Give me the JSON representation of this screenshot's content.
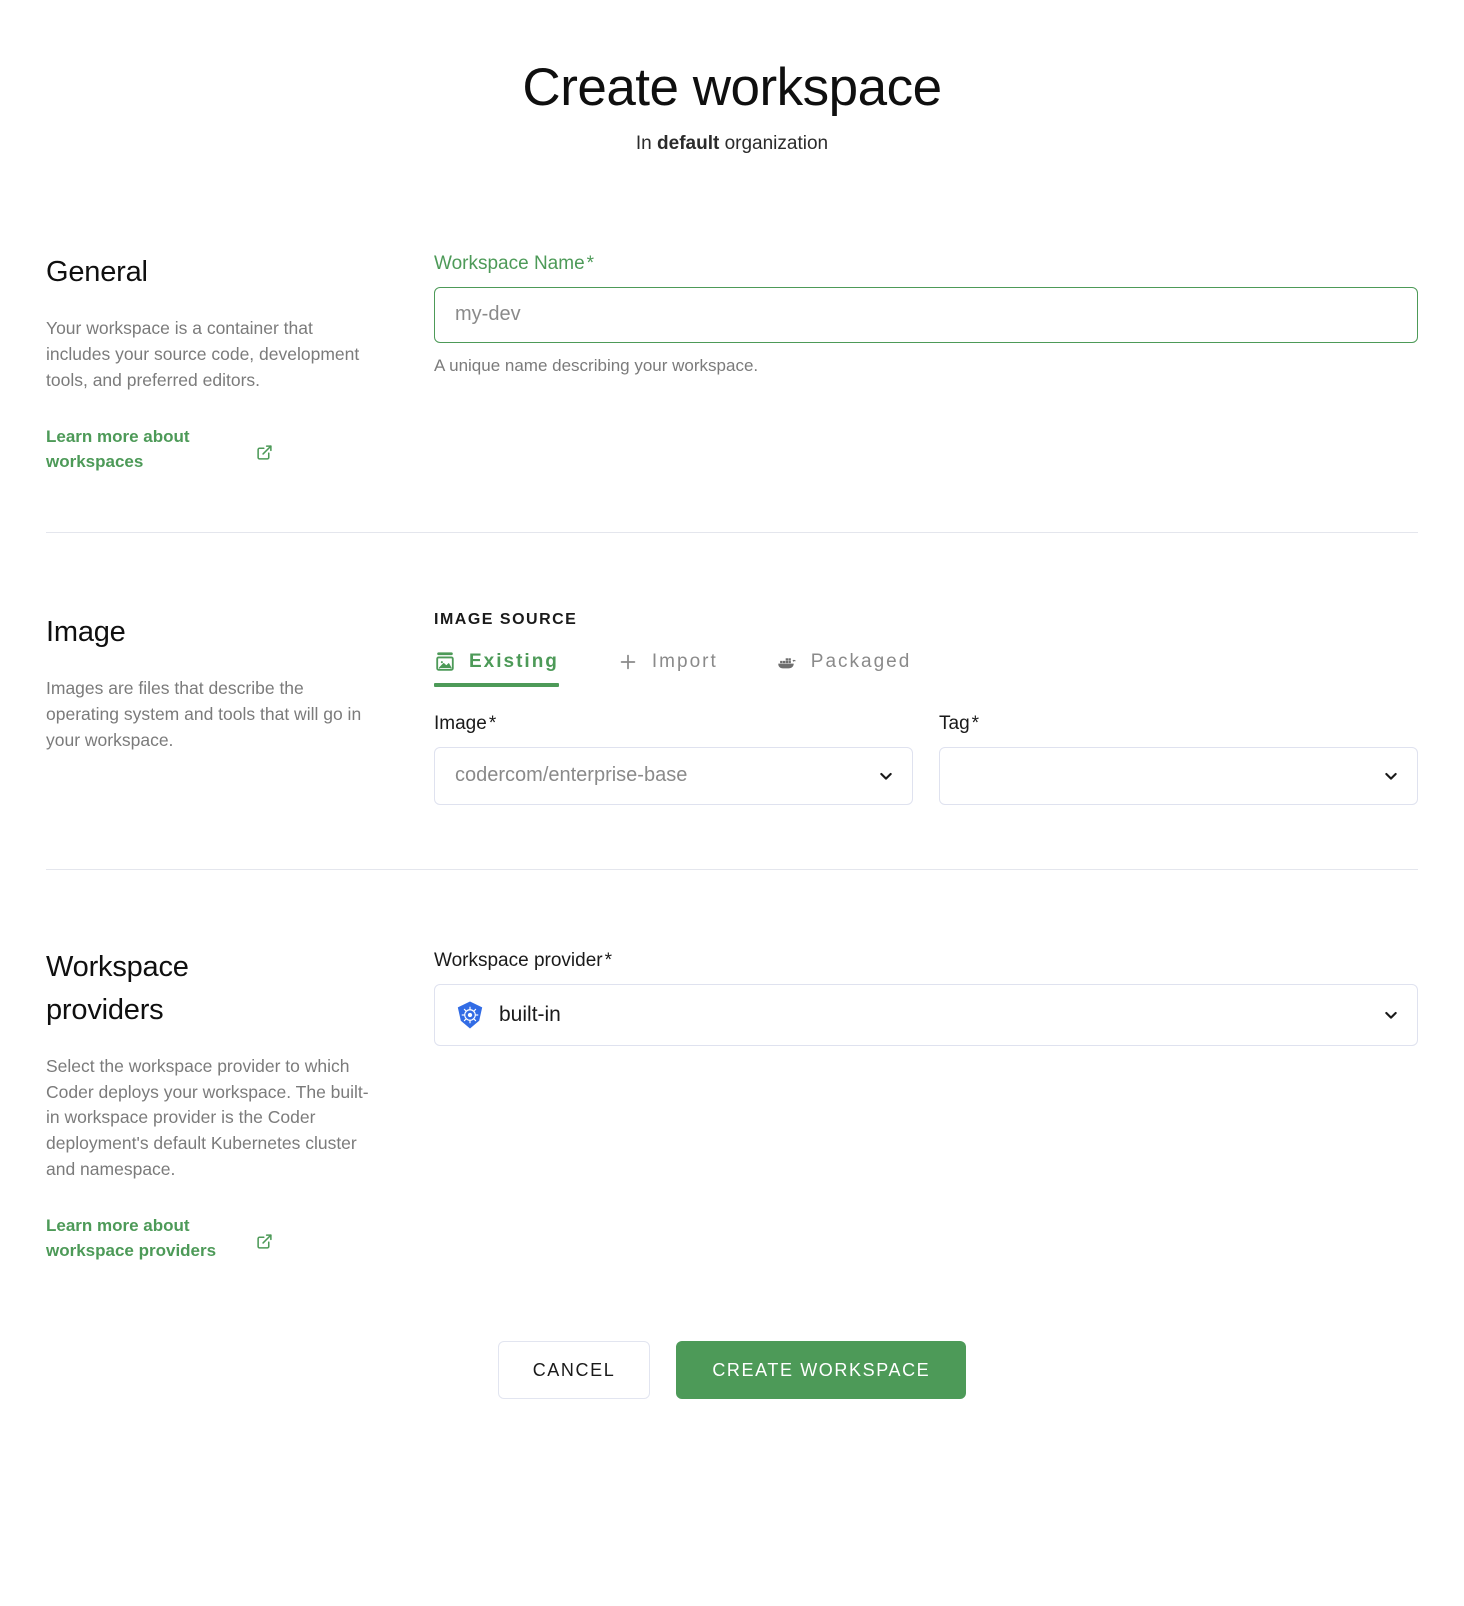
{
  "header": {
    "title": "Create workspace",
    "subtitle_prefix": "In",
    "subtitle_bold": "default",
    "subtitle_suffix": "organization"
  },
  "accent": {
    "green": "#4d9a58",
    "kubernetes_blue": "#326ce5",
    "muted_text": "#7b7b7b",
    "border": "#dfe2ef"
  },
  "general": {
    "title": "General",
    "description": "Your workspace is a container that includes your source code, development tools, and preferred editors.",
    "learn_more": "Learn more about workspaces",
    "external_link_icon": "external-link-icon",
    "name_field": {
      "label": "Workspace Name",
      "required_marker": "*",
      "value": "",
      "placeholder": "my-dev",
      "helper": "A unique name describing your workspace."
    }
  },
  "image": {
    "title": "Image",
    "description": "Images are files that describe the operating system and tools that will go in your workspace.",
    "source_overline": "IMAGE SOURCE",
    "tabs": [
      {
        "label": "Existing",
        "icon": "image-icon",
        "active": true
      },
      {
        "label": "Import",
        "icon": "plus-icon",
        "active": false
      },
      {
        "label": "Packaged",
        "icon": "docker-whale-icon",
        "active": false
      }
    ],
    "image_select": {
      "label": "Image",
      "required_marker": "*",
      "value": "codercom/enterprise-base",
      "caret_icon": "chevron-down-icon"
    },
    "tag_select": {
      "label": "Tag",
      "required_marker": "*",
      "value": "",
      "caret_icon": "chevron-down-icon"
    }
  },
  "providers": {
    "title": "Workspace providers",
    "description": "Select the workspace provider to which Coder deploys your workspace. The built-in workspace provider is the Coder deployment's default Kubernetes cluster and namespace.",
    "learn_more": "Learn more about workspace providers",
    "external_link_icon": "external-link-icon",
    "provider_select": {
      "label": "Workspace provider",
      "required_marker": "*",
      "value": "built-in",
      "icon": "kubernetes-icon",
      "caret_icon": "chevron-down-icon"
    }
  },
  "footer": {
    "cancel_label": "CANCEL",
    "submit_label": "CREATE WORKSPACE"
  }
}
